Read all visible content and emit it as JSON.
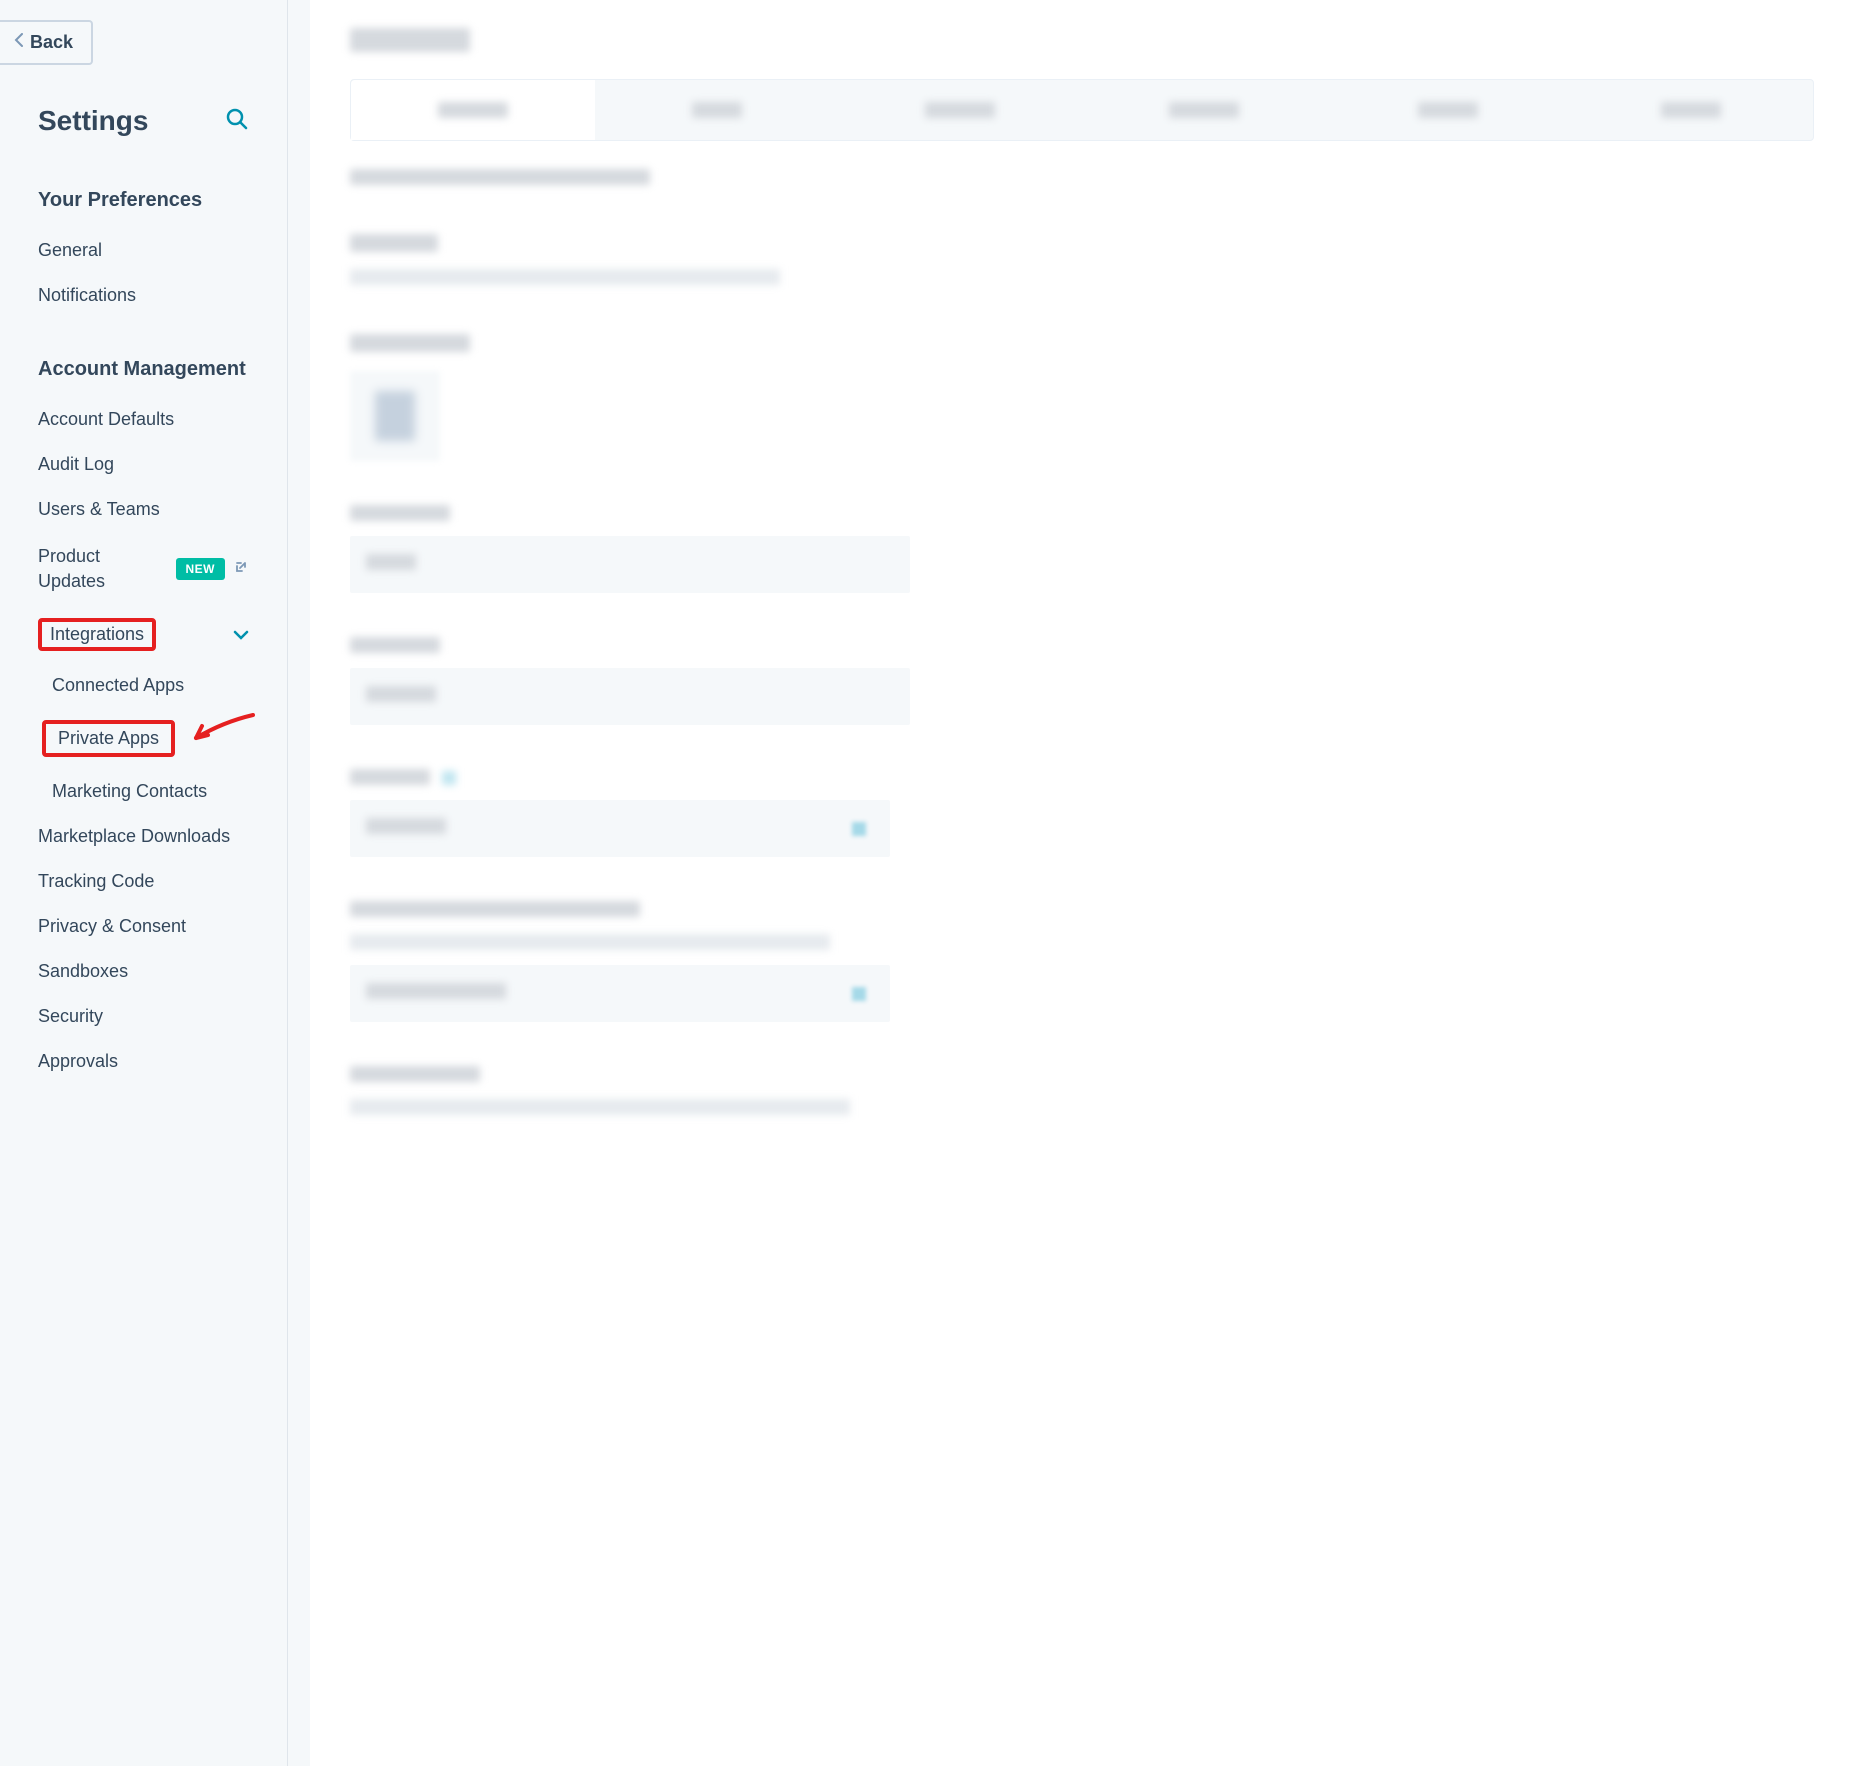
{
  "sidebar": {
    "back_label": "Back",
    "title": "Settings",
    "section_preferences": "Your Preferences",
    "preferences_items": [
      {
        "label": "General"
      },
      {
        "label": "Notifications"
      }
    ],
    "section_account": "Account Management",
    "account_items": {
      "account_defaults": "Account Defaults",
      "audit_log": "Audit Log",
      "users_teams": "Users & Teams",
      "product_updates": "Product Updates",
      "product_updates_badge": "NEW",
      "integrations": "Integrations",
      "integrations_sub": {
        "connected_apps": "Connected Apps",
        "private_apps": "Private Apps",
        "marketing_contacts": "Marketing Contacts"
      },
      "marketplace_downloads": "Marketplace Downloads",
      "tracking_code": "Tracking Code",
      "privacy_consent": "Privacy & Consent",
      "sandboxes": "Sandboxes",
      "security": "Security",
      "approvals": "Approvals"
    }
  }
}
